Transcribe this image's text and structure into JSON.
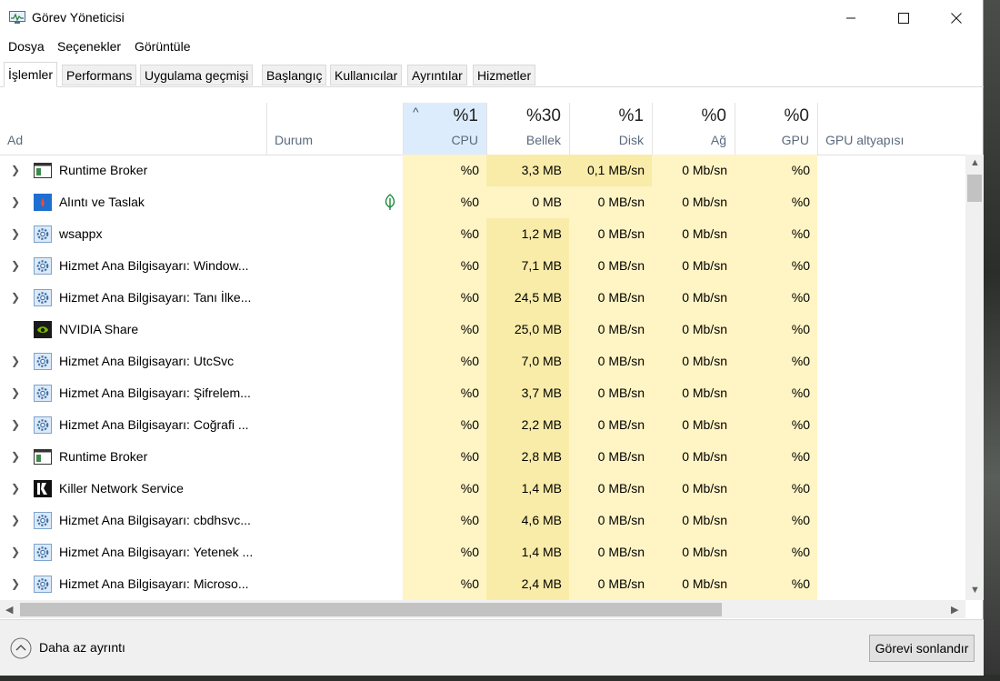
{
  "window": {
    "title": "Görev Yöneticisi"
  },
  "menu": [
    "Dosya",
    "Seçenekler",
    "Görüntüle"
  ],
  "tabs": [
    "İşlemler",
    "Performans",
    "Uygulama geçmişi",
    "Başlangıç",
    "Kullanıcılar",
    "Ayrıntılar",
    "Hizmetler"
  ],
  "active_tab": "İşlemler",
  "columns": {
    "name": "Ad",
    "status": "Durum",
    "cpu": {
      "label": "CPU",
      "total": "%1"
    },
    "memory": {
      "label": "Bellek",
      "total": "%30"
    },
    "disk": {
      "label": "Disk",
      "total": "%1"
    },
    "network": {
      "label": "Ağ",
      "total": "%0"
    },
    "gpu": {
      "label": "GPU",
      "total": "%0"
    },
    "gpu_engine": "GPU altyapısı"
  },
  "processes": [
    {
      "name": "Runtime Broker",
      "icon": "runtime-broker-icon",
      "expandable": true,
      "status_icon": "",
      "cpu": "%0",
      "memory": "3,3 MB",
      "disk": "0,1 MB/sn",
      "network": "0 Mb/sn",
      "gpu": "%0"
    },
    {
      "name": "Alıntı ve Taslak",
      "icon": "snip-sketch-icon",
      "expandable": true,
      "status_icon": "leaf-icon",
      "cpu": "%0",
      "memory": "0 MB",
      "disk": "0 MB/sn",
      "network": "0 Mb/sn",
      "gpu": "%0"
    },
    {
      "name": "wsappx",
      "icon": "gear-icon",
      "expandable": true,
      "status_icon": "",
      "cpu": "%0",
      "memory": "1,2 MB",
      "disk": "0 MB/sn",
      "network": "0 Mb/sn",
      "gpu": "%0"
    },
    {
      "name": "Hizmet Ana Bilgisayarı: Window...",
      "icon": "gear-icon",
      "expandable": true,
      "status_icon": "",
      "cpu": "%0",
      "memory": "7,1 MB",
      "disk": "0 MB/sn",
      "network": "0 Mb/sn",
      "gpu": "%0"
    },
    {
      "name": "Hizmet Ana Bilgisayarı: Tanı İlke...",
      "icon": "gear-icon",
      "expandable": true,
      "status_icon": "",
      "cpu": "%0",
      "memory": "24,5 MB",
      "disk": "0 MB/sn",
      "network": "0 Mb/sn",
      "gpu": "%0"
    },
    {
      "name": "NVIDIA Share",
      "icon": "nvidia-icon",
      "expandable": false,
      "status_icon": "",
      "cpu": "%0",
      "memory": "25,0 MB",
      "disk": "0 MB/sn",
      "network": "0 Mb/sn",
      "gpu": "%0"
    },
    {
      "name": "Hizmet Ana Bilgisayarı: UtcSvc",
      "icon": "gear-icon",
      "expandable": true,
      "status_icon": "",
      "cpu": "%0",
      "memory": "7,0 MB",
      "disk": "0 MB/sn",
      "network": "0 Mb/sn",
      "gpu": "%0"
    },
    {
      "name": "Hizmet Ana Bilgisayarı: Şifrelem...",
      "icon": "gear-icon",
      "expandable": true,
      "status_icon": "",
      "cpu": "%0",
      "memory": "3,7 MB",
      "disk": "0 MB/sn",
      "network": "0 Mb/sn",
      "gpu": "%0"
    },
    {
      "name": "Hizmet Ana Bilgisayarı: Coğrafi ...",
      "icon": "gear-icon",
      "expandable": true,
      "status_icon": "",
      "cpu": "%0",
      "memory": "2,2 MB",
      "disk": "0 MB/sn",
      "network": "0 Mb/sn",
      "gpu": "%0"
    },
    {
      "name": "Runtime Broker",
      "icon": "runtime-broker-icon",
      "expandable": true,
      "status_icon": "",
      "cpu": "%0",
      "memory": "2,8 MB",
      "disk": "0 MB/sn",
      "network": "0 Mb/sn",
      "gpu": "%0"
    },
    {
      "name": "Killer Network Service",
      "icon": "killer-icon",
      "expandable": true,
      "status_icon": "",
      "cpu": "%0",
      "memory": "1,4 MB",
      "disk": "0 MB/sn",
      "network": "0 Mb/sn",
      "gpu": "%0"
    },
    {
      "name": "Hizmet Ana Bilgisayarı: cbdhsvc...",
      "icon": "gear-icon",
      "expandable": true,
      "status_icon": "",
      "cpu": "%0",
      "memory": "4,6 MB",
      "disk": "0 MB/sn",
      "network": "0 Mb/sn",
      "gpu": "%0"
    },
    {
      "name": "Hizmet Ana Bilgisayarı: Yetenek ...",
      "icon": "gear-icon",
      "expandable": true,
      "status_icon": "",
      "cpu": "%0",
      "memory": "1,4 MB",
      "disk": "0 MB/sn",
      "network": "0 Mb/sn",
      "gpu": "%0"
    },
    {
      "name": "Hizmet Ana Bilgisayarı: Microso...",
      "icon": "gear-icon",
      "expandable": true,
      "status_icon": "",
      "cpu": "%0",
      "memory": "2,4 MB",
      "disk": "0 MB/sn",
      "network": "0 Mb/sn",
      "gpu": "%0"
    }
  ],
  "footer": {
    "less_details": "Daha az ayrıntı",
    "end_task": "Görevi sonlandır"
  },
  "colors": {
    "heat_light": "#fff4c4",
    "heat_medium": "#f9eca8",
    "header_selected": "#dcecfc",
    "leaf_green": "#1a8a3a"
  }
}
